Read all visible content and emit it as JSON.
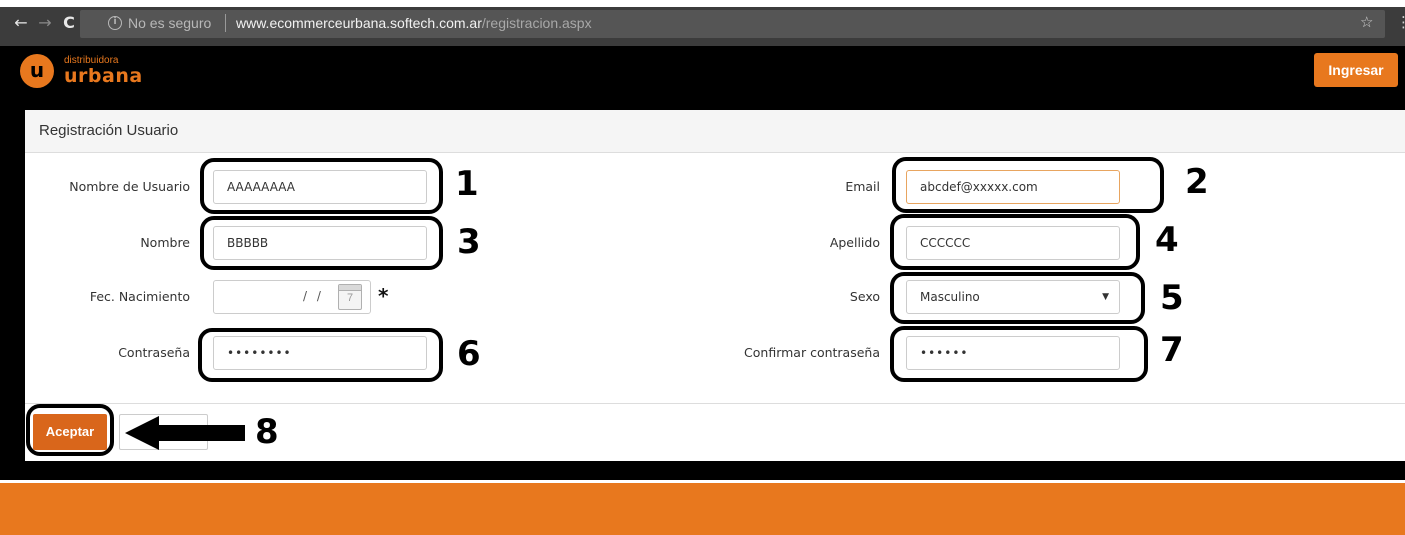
{
  "browser": {
    "back_glyph": "←",
    "forward_glyph": "→",
    "reload_glyph": "C",
    "info_glyph": "i",
    "security_text": "No es seguro",
    "url_host": "www.ecommerceurbana.softech.com.ar",
    "url_path": "/registracion.aspx",
    "star_glyph": "☆",
    "menu_glyph": "⋮"
  },
  "header": {
    "logo_letter": "u",
    "logo_subtitle": "distribuidora",
    "logo_title": "urbana",
    "login_button": "Ingresar",
    "accent_color": "#e8781e"
  },
  "form": {
    "title": "Registración Usuario",
    "fields": {
      "username": {
        "label": "Nombre de Usuario",
        "value": "AAAAAAAA"
      },
      "email": {
        "label": "Email",
        "value": "abcdef@xxxxx.com"
      },
      "first_name": {
        "label": "Nombre",
        "value": "BBBBB"
      },
      "last_name": {
        "label": "Apellido",
        "value": "CCCCCC"
      },
      "birth_date": {
        "label": "Fec. Nacimiento",
        "value": "/ /",
        "calendar_glyph": "7",
        "required_mark": "*"
      },
      "sex": {
        "label": "Sexo",
        "value": "Masculino",
        "arrow_glyph": "▼"
      },
      "password": {
        "label": "Contraseña",
        "value": "••••••••"
      },
      "confirm_password": {
        "label": "Confirmar contraseña",
        "value": "••••••"
      }
    },
    "submit_button": "Aceptar",
    "secondary_button": ""
  },
  "annotations": [
    "1",
    "2",
    "3",
    "4",
    "5",
    "6",
    "7",
    "8"
  ]
}
